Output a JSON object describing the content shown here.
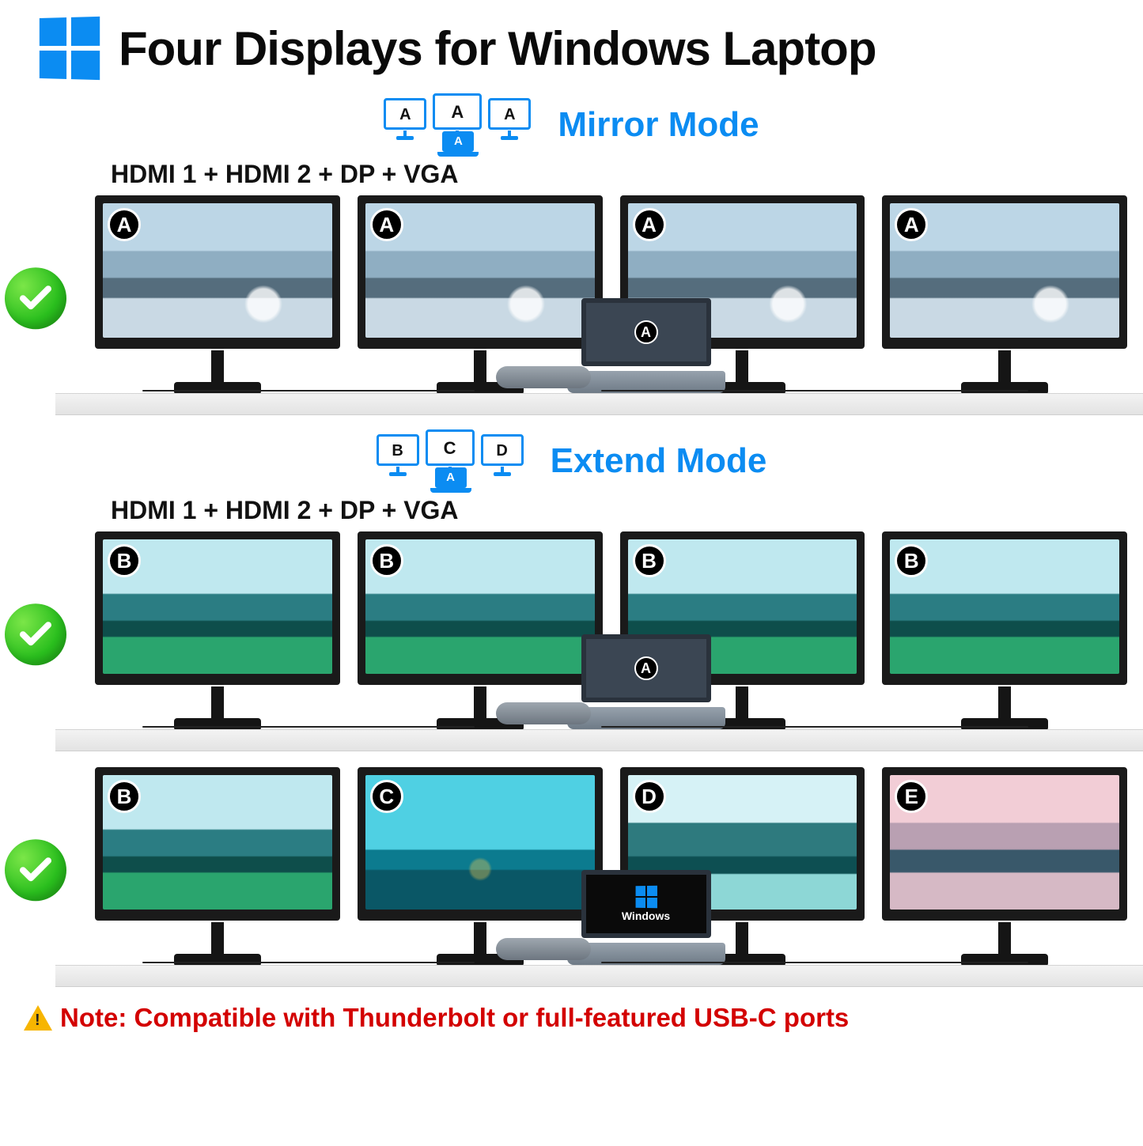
{
  "header": {
    "title": "Four Displays for Windows Laptop"
  },
  "modes": {
    "mirror": {
      "label": "Mirror Mode",
      "mini_monitors": [
        "A",
        "A",
        "A"
      ],
      "mini_laptop": "A"
    },
    "extend": {
      "label": "Extend Mode",
      "mini_monitors": [
        "B",
        "C",
        "D"
      ],
      "mini_laptop": "A"
    }
  },
  "sections": {
    "mirror": {
      "ports_line": "HDMI 1 + HDMI 2 + DP + VGA",
      "monitor_badges": [
        "A",
        "A",
        "A",
        "A"
      ],
      "laptop_badge": "A"
    },
    "extend1": {
      "ports_line": "HDMI 1 + HDMI 2 + DP + VGA",
      "monitor_badges": [
        "B",
        "B",
        "B",
        "B"
      ],
      "laptop_badge": "A"
    },
    "extend2": {
      "monitor_badges": [
        "B",
        "C",
        "D",
        "E"
      ],
      "laptop_os_label": "Windows"
    }
  },
  "note": {
    "text": "Note: Compatible with Thunderbolt or full-featured USB-C ports"
  },
  "colors": {
    "brand_blue": "#0b8cf2",
    "note_red": "#d30000",
    "check_green": "#2abf1e",
    "warn_yellow": "#f7b500"
  }
}
